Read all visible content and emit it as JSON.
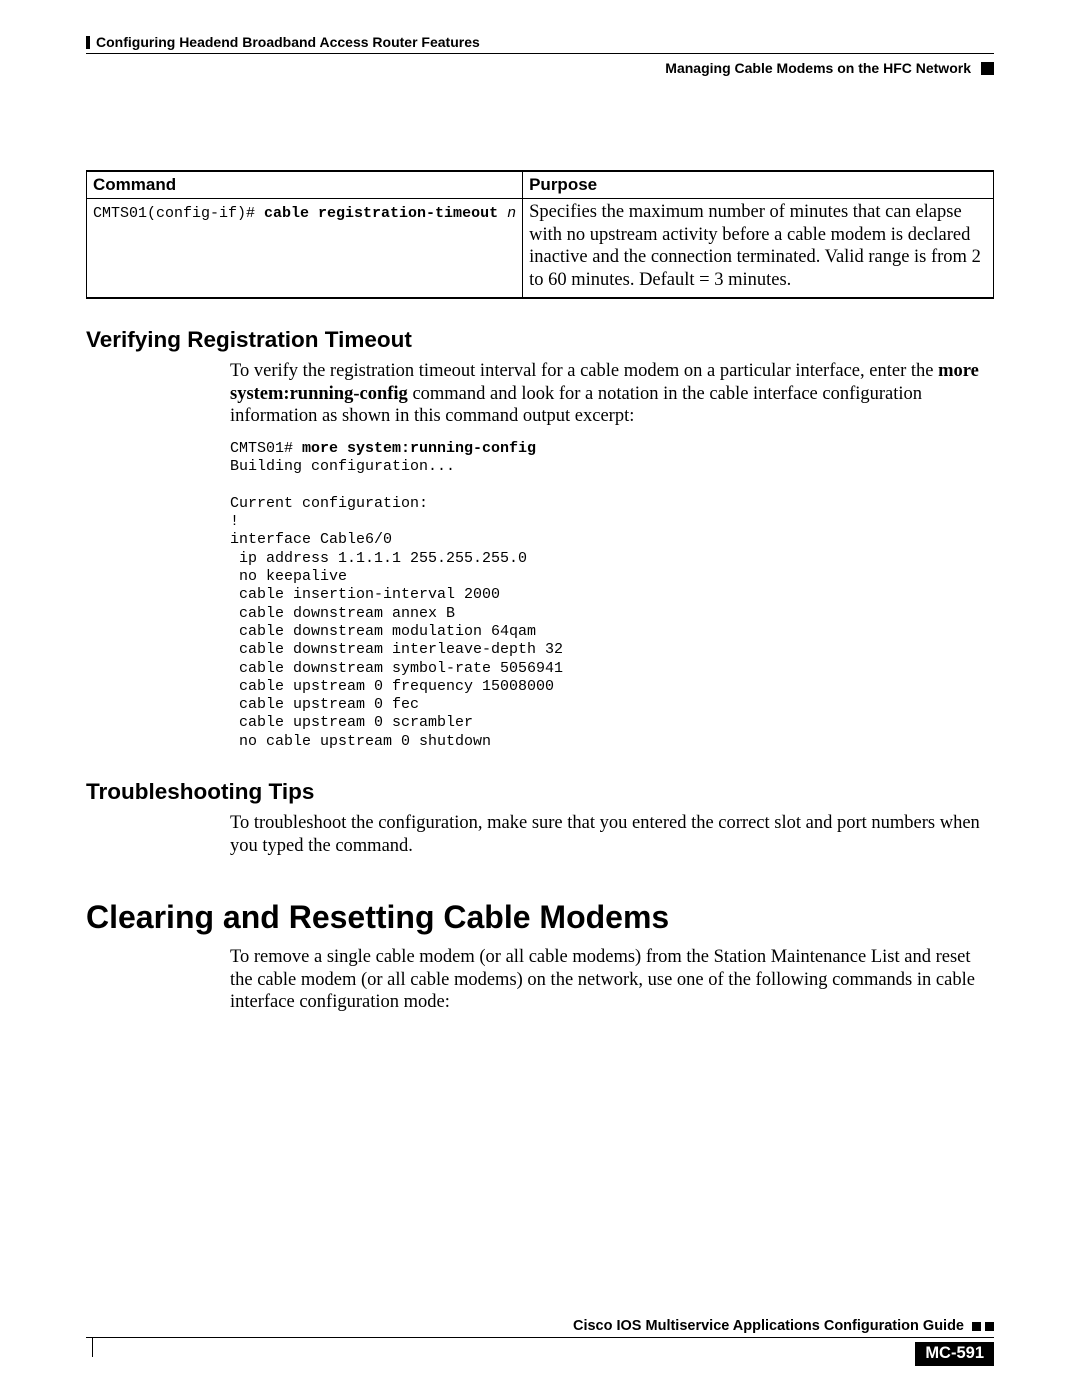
{
  "header": {
    "chapter": "Configuring Headend Broadband Access Router Features",
    "section": "Managing Cable Modems on the HFC Network"
  },
  "table": {
    "headers": {
      "command": "Command",
      "purpose": "Purpose"
    },
    "row": {
      "prompt": "CMTS01(config-if)# ",
      "cmd": "cable registration-timeout",
      "arg": " n",
      "purpose": "Specifies the maximum number of minutes that can elapse with no upstream activity before a cable modem is declared inactive and the connection terminated. Valid range is from 2 to 60 minutes. Default = 3 minutes."
    }
  },
  "sections": {
    "verify": {
      "heading": "Verifying Registration Timeout",
      "para_pre": "To verify the registration timeout interval for a cable modem on a particular interface, enter the ",
      "para_bold": "more system:running-config",
      "para_post": " command and look for a notation in the cable interface configuration information as shown in this command output excerpt:",
      "code_prompt": "CMTS01# ",
      "code_cmd": "more system:running-config",
      "code_body": "Building configuration...\n\nCurrent configuration:\n!\ninterface Cable6/0\n ip address 1.1.1.1 255.255.255.0\n no keepalive\n cable insertion-interval 2000\n cable downstream annex B\n cable downstream modulation 64qam\n cable downstream interleave-depth 32\n cable downstream symbol-rate 5056941\n cable upstream 0 frequency 15008000\n cable upstream 0 fec\n cable upstream 0 scrambler\n no cable upstream 0 shutdown"
    },
    "trouble": {
      "heading": "Troubleshooting Tips",
      "para": "To troubleshoot the configuration, make sure that you entered the correct slot and port numbers when you typed the command."
    },
    "clearing": {
      "heading": "Clearing and Resetting Cable Modems",
      "para": "To remove a single cable modem (or all cable modems) from the Station Maintenance List and reset the cable modem (or all cable modems) on the network, use one of the following commands in cable interface configuration mode:"
    }
  },
  "footer": {
    "title": "Cisco IOS Multiservice Applications Configuration Guide",
    "page": "MC-591"
  }
}
